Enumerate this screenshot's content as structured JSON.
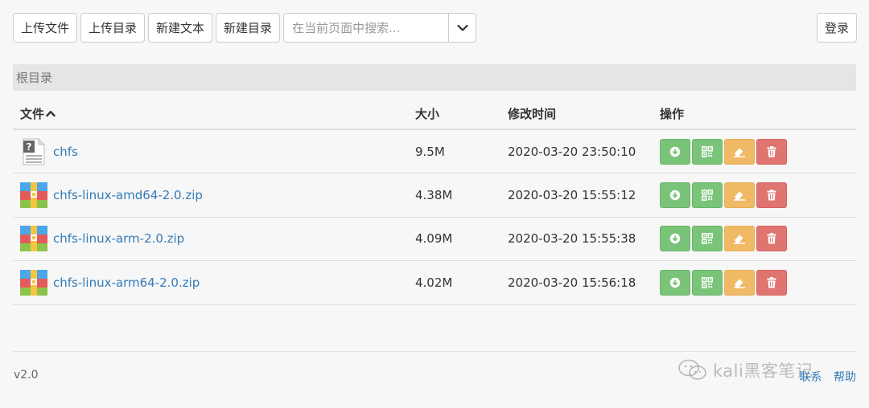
{
  "toolbar": {
    "upload_file": "上传文件",
    "upload_dir": "上传目录",
    "new_text": "新建文本",
    "new_dir": "新建目录",
    "search_placeholder": "在当前页面中搜索...",
    "login": "登录"
  },
  "breadcrumb": "根目录",
  "table": {
    "headers": {
      "name": "文件",
      "size": "大小",
      "modified": "修改时间",
      "actions": "操作"
    },
    "rows": [
      {
        "name": "chfs",
        "size": "9.5M",
        "modified": "2020-03-20 23:50:10",
        "icon": "unknown-file-icon"
      },
      {
        "name": "chfs-linux-amd64-2.0.zip",
        "size": "4.38M",
        "modified": "2020-03-20 15:55:12",
        "icon": "zip-file-icon"
      },
      {
        "name": "chfs-linux-arm-2.0.zip",
        "size": "4.09M",
        "modified": "2020-03-20 15:55:38",
        "icon": "zip-file-icon"
      },
      {
        "name": "chfs-linux-arm64-2.0.zip",
        "size": "4.02M",
        "modified": "2020-03-20 15:56:18",
        "icon": "zip-file-icon"
      }
    ]
  },
  "footer": {
    "version": "v2.0",
    "contact": "联系",
    "help": "帮助"
  },
  "watermark": "kali黑客笔记",
  "colors": {
    "link": "#337ab7",
    "download": "#7ac47a",
    "qrcode": "#7ac47a",
    "rename": "#f0b966",
    "delete": "#e07471"
  }
}
